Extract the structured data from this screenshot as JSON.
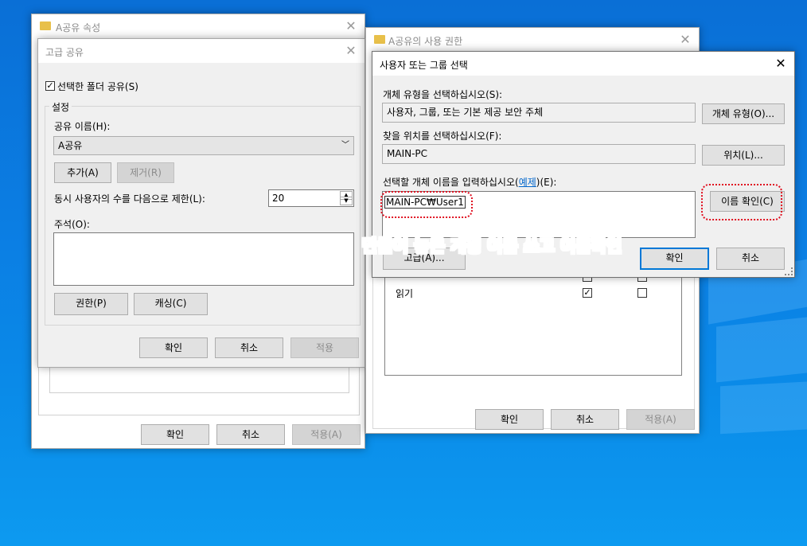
{
  "props_window": {
    "title": "A공유 속성",
    "ok": "확인",
    "cancel": "취소",
    "apply": "적용(A)"
  },
  "advanced_share": {
    "title": "고급 공유",
    "share_checkbox": "선택한 폴더 공유(S)",
    "settings_group": "설정",
    "share_name_label": "공유 이름(H):",
    "share_name_value": "A공유",
    "add_button": "추가(A)",
    "remove_button": "제거(R)",
    "limit_label": "동시 사용자의 수를 다음으로 제한(L):",
    "limit_value": "20",
    "comment_label": "주석(O):",
    "permissions_button": "권한(P)",
    "caching_button": "캐싱(C)",
    "ok": "확인",
    "cancel": "취소",
    "apply": "적용"
  },
  "permissions_window": {
    "title": "A공유의 사용 권한",
    "read_label": "읽기",
    "read_allow": true,
    "read_deny": false,
    "ok": "확인",
    "cancel": "취소",
    "apply": "적용(A)"
  },
  "select_users": {
    "title": "사용자 또는 그룹 선택",
    "object_type_label": "개체 유형을 선택하십시오(S):",
    "object_type_value": "사용자, 그룹, 또는 기본 제공 보안 주체",
    "object_type_button": "개체 유형(O)...",
    "location_label": "찾을 위치를 선택하십시오(F):",
    "location_value": "MAIN-PC",
    "location_button": "위치(L)...",
    "enter_label_prefix": "선택할 개체 이름을 입력하십시오(",
    "enter_label_link": "예제",
    "enter_label_suffix": ")(E):",
    "entered_name": "MAIN-PC₩User1",
    "check_names_button": "이름 확인(C)",
    "advanced_button": "고급(A)...",
    "ok": "확인",
    "cancel": "취소"
  },
  "annotation": "만들어 놓은 계정 이름 쓰고 이름확인"
}
